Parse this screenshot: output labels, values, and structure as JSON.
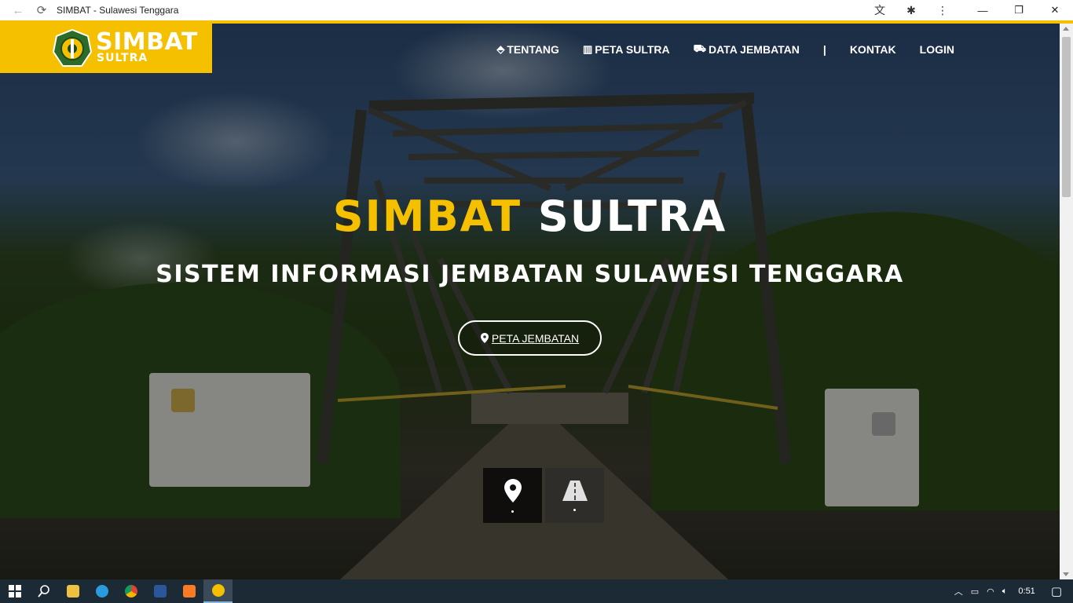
{
  "browser": {
    "title": "SIMBAT - Sulawesi Tenggara",
    "back_icon": "←",
    "reload_icon": "⟳",
    "ext_translate_icon": "文",
    "ext_puzzle_icon": "✱",
    "menu_icon": "⋮",
    "minimize_icon": "—",
    "restore_icon": "❐",
    "close_icon": "✕"
  },
  "brand": {
    "name_main": "SIMBAT",
    "name_sub": "SULTRA",
    "accent": "#f5c000"
  },
  "nav": {
    "items": [
      {
        "label": "TENTANG",
        "icon": "⬘"
      },
      {
        "label": "PETA SULTRA",
        "icon": "▥"
      },
      {
        "label": "DATA JEMBATAN",
        "icon": "⛟"
      }
    ],
    "separator": "|",
    "kontak": "KONTAK",
    "login": "LOGIN"
  },
  "hero": {
    "title_yellow": "SIMBAT",
    "title_white": "SULTRA",
    "subtitle": "SISTEM INFORMASI JEMBATAN SULAWESI TENGGARA",
    "button_label": "PETA JEMBATAN",
    "button_icon": "⬤"
  },
  "tiles": [
    {
      "icon": "map-pin-icon"
    },
    {
      "icon": "road-icon"
    }
  ],
  "taskbar": {
    "clock": "0:51",
    "pinned": [
      "file-explorer",
      "edge",
      "chrome",
      "word",
      "xampp",
      "simbat"
    ]
  }
}
